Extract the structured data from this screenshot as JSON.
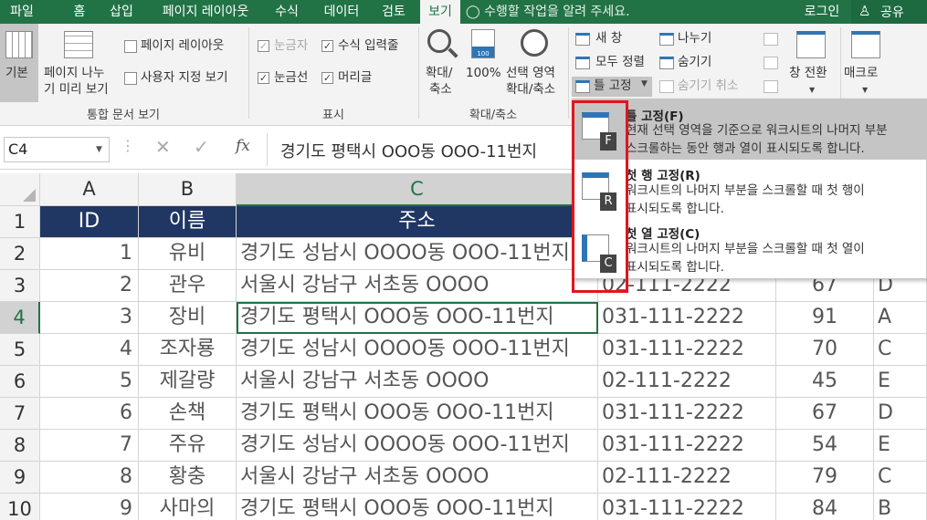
{
  "tabs": [
    "파일",
    "홈",
    "삽입",
    "페이지 레이아웃",
    "수식",
    "데이터",
    "검토",
    "보기"
  ],
  "tell_me": "수행할 작업을 알려 주세요.",
  "account": {
    "login": "로그인",
    "share": "공유"
  },
  "ribbon": {
    "workbook_views": {
      "normal": "기본",
      "page_break": [
        "페이지 나누",
        "기 미리 보기"
      ],
      "page_layout": "페이지 레이아웃",
      "custom_views": "사용자 지정 보기",
      "group": "통합 문서 보기"
    },
    "show": {
      "ruler": "눈금자",
      "formula_bar": "수식 입력줄",
      "gridlines": "눈금선",
      "headings": "머리글",
      "group": "표시"
    },
    "zoom": {
      "zoom": [
        "확대/",
        "축소"
      ],
      "hundred": "100%",
      "zoom_sel": [
        "선택 영역",
        "확대/축소"
      ],
      "group": "확대/축소"
    },
    "window": {
      "new_window": "새 창",
      "arrange_all": "모두 정렬",
      "freeze": "틀 고정",
      "split": "나누기",
      "hide": "숨기기",
      "unhide": "숨기기 취소",
      "switch": "창 전환"
    },
    "macro": "매크로"
  },
  "formula": {
    "namebox": "C4",
    "fx": "fx",
    "value": "경기도 평택시 OOO동 OOO-11번지"
  },
  "grid": {
    "cols": [
      "A",
      "B",
      "C"
    ],
    "headers": [
      "ID",
      "이름",
      "주소"
    ],
    "rows": [
      {
        "n": "2",
        "id": "1",
        "name": "유비",
        "addr": "경기도 성남시 OOOO동 OOO-11번지",
        "tel": "",
        "score": "",
        "x": ""
      },
      {
        "n": "3",
        "id": "2",
        "name": "관우",
        "addr": "서울시 강남구 서초동 OOOO",
        "tel": "02-111-2222",
        "score": "67",
        "x": "D"
      },
      {
        "n": "4",
        "id": "3",
        "name": "장비",
        "addr": "경기도 평택시 OOO동 OOO-11번지",
        "tel": "031-111-2222",
        "score": "91",
        "x": "A"
      },
      {
        "n": "5",
        "id": "4",
        "name": "조자룡",
        "addr": "경기도 성남시 OOOO동 OOO-11번지",
        "tel": "031-111-2222",
        "score": "70",
        "x": "C"
      },
      {
        "n": "6",
        "id": "5",
        "name": "제갈량",
        "addr": "서울시 강남구 서초동 OOOO",
        "tel": "02-111-2222",
        "score": "45",
        "x": "E"
      },
      {
        "n": "7",
        "id": "6",
        "name": "손책",
        "addr": "경기도 평택시 OOO동 OOO-11번지",
        "tel": "031-111-2222",
        "score": "67",
        "x": "D"
      },
      {
        "n": "8",
        "id": "7",
        "name": "주유",
        "addr": "경기도 성남시 OOOO동 OOO-11번지",
        "tel": "031-111-2222",
        "score": "54",
        "x": "E"
      },
      {
        "n": "9",
        "id": "8",
        "name": "황충",
        "addr": "서울시 강남구 서초동 OOOO",
        "tel": "02-111-2222",
        "score": "79",
        "x": "C"
      },
      {
        "n": "10",
        "id": "9",
        "name": "사마의",
        "addr": "경기도 평택시 OOO동 OOO-11번지",
        "tel": "031-111-2222",
        "score": "84",
        "x": "B"
      }
    ]
  },
  "dropdown": {
    "items": [
      {
        "title": "틀 고정(F)",
        "desc": [
          "현재 선택 영역을 기준으로 워크시트의 나머지 부분",
          "스크롤하는 동안 행과 열이 표시되도록 합니다."
        ],
        "icon": "F"
      },
      {
        "title": "첫 행 고정(R)",
        "desc": [
          "워크시트의 나머지 부분을 스크롤할 때 첫 행이",
          "표시되도록 합니다."
        ],
        "icon": "R"
      },
      {
        "title": "첫 열 고정(C)",
        "desc": [
          "워크시트의 나머지 부분을 스크롤할 때 첫 열이",
          "표시되도록 합니다."
        ],
        "icon": "C"
      }
    ]
  },
  "colors": {
    "excel_green": "#217346",
    "header_fill": "#203764",
    "highlight": "#e0161b"
  }
}
